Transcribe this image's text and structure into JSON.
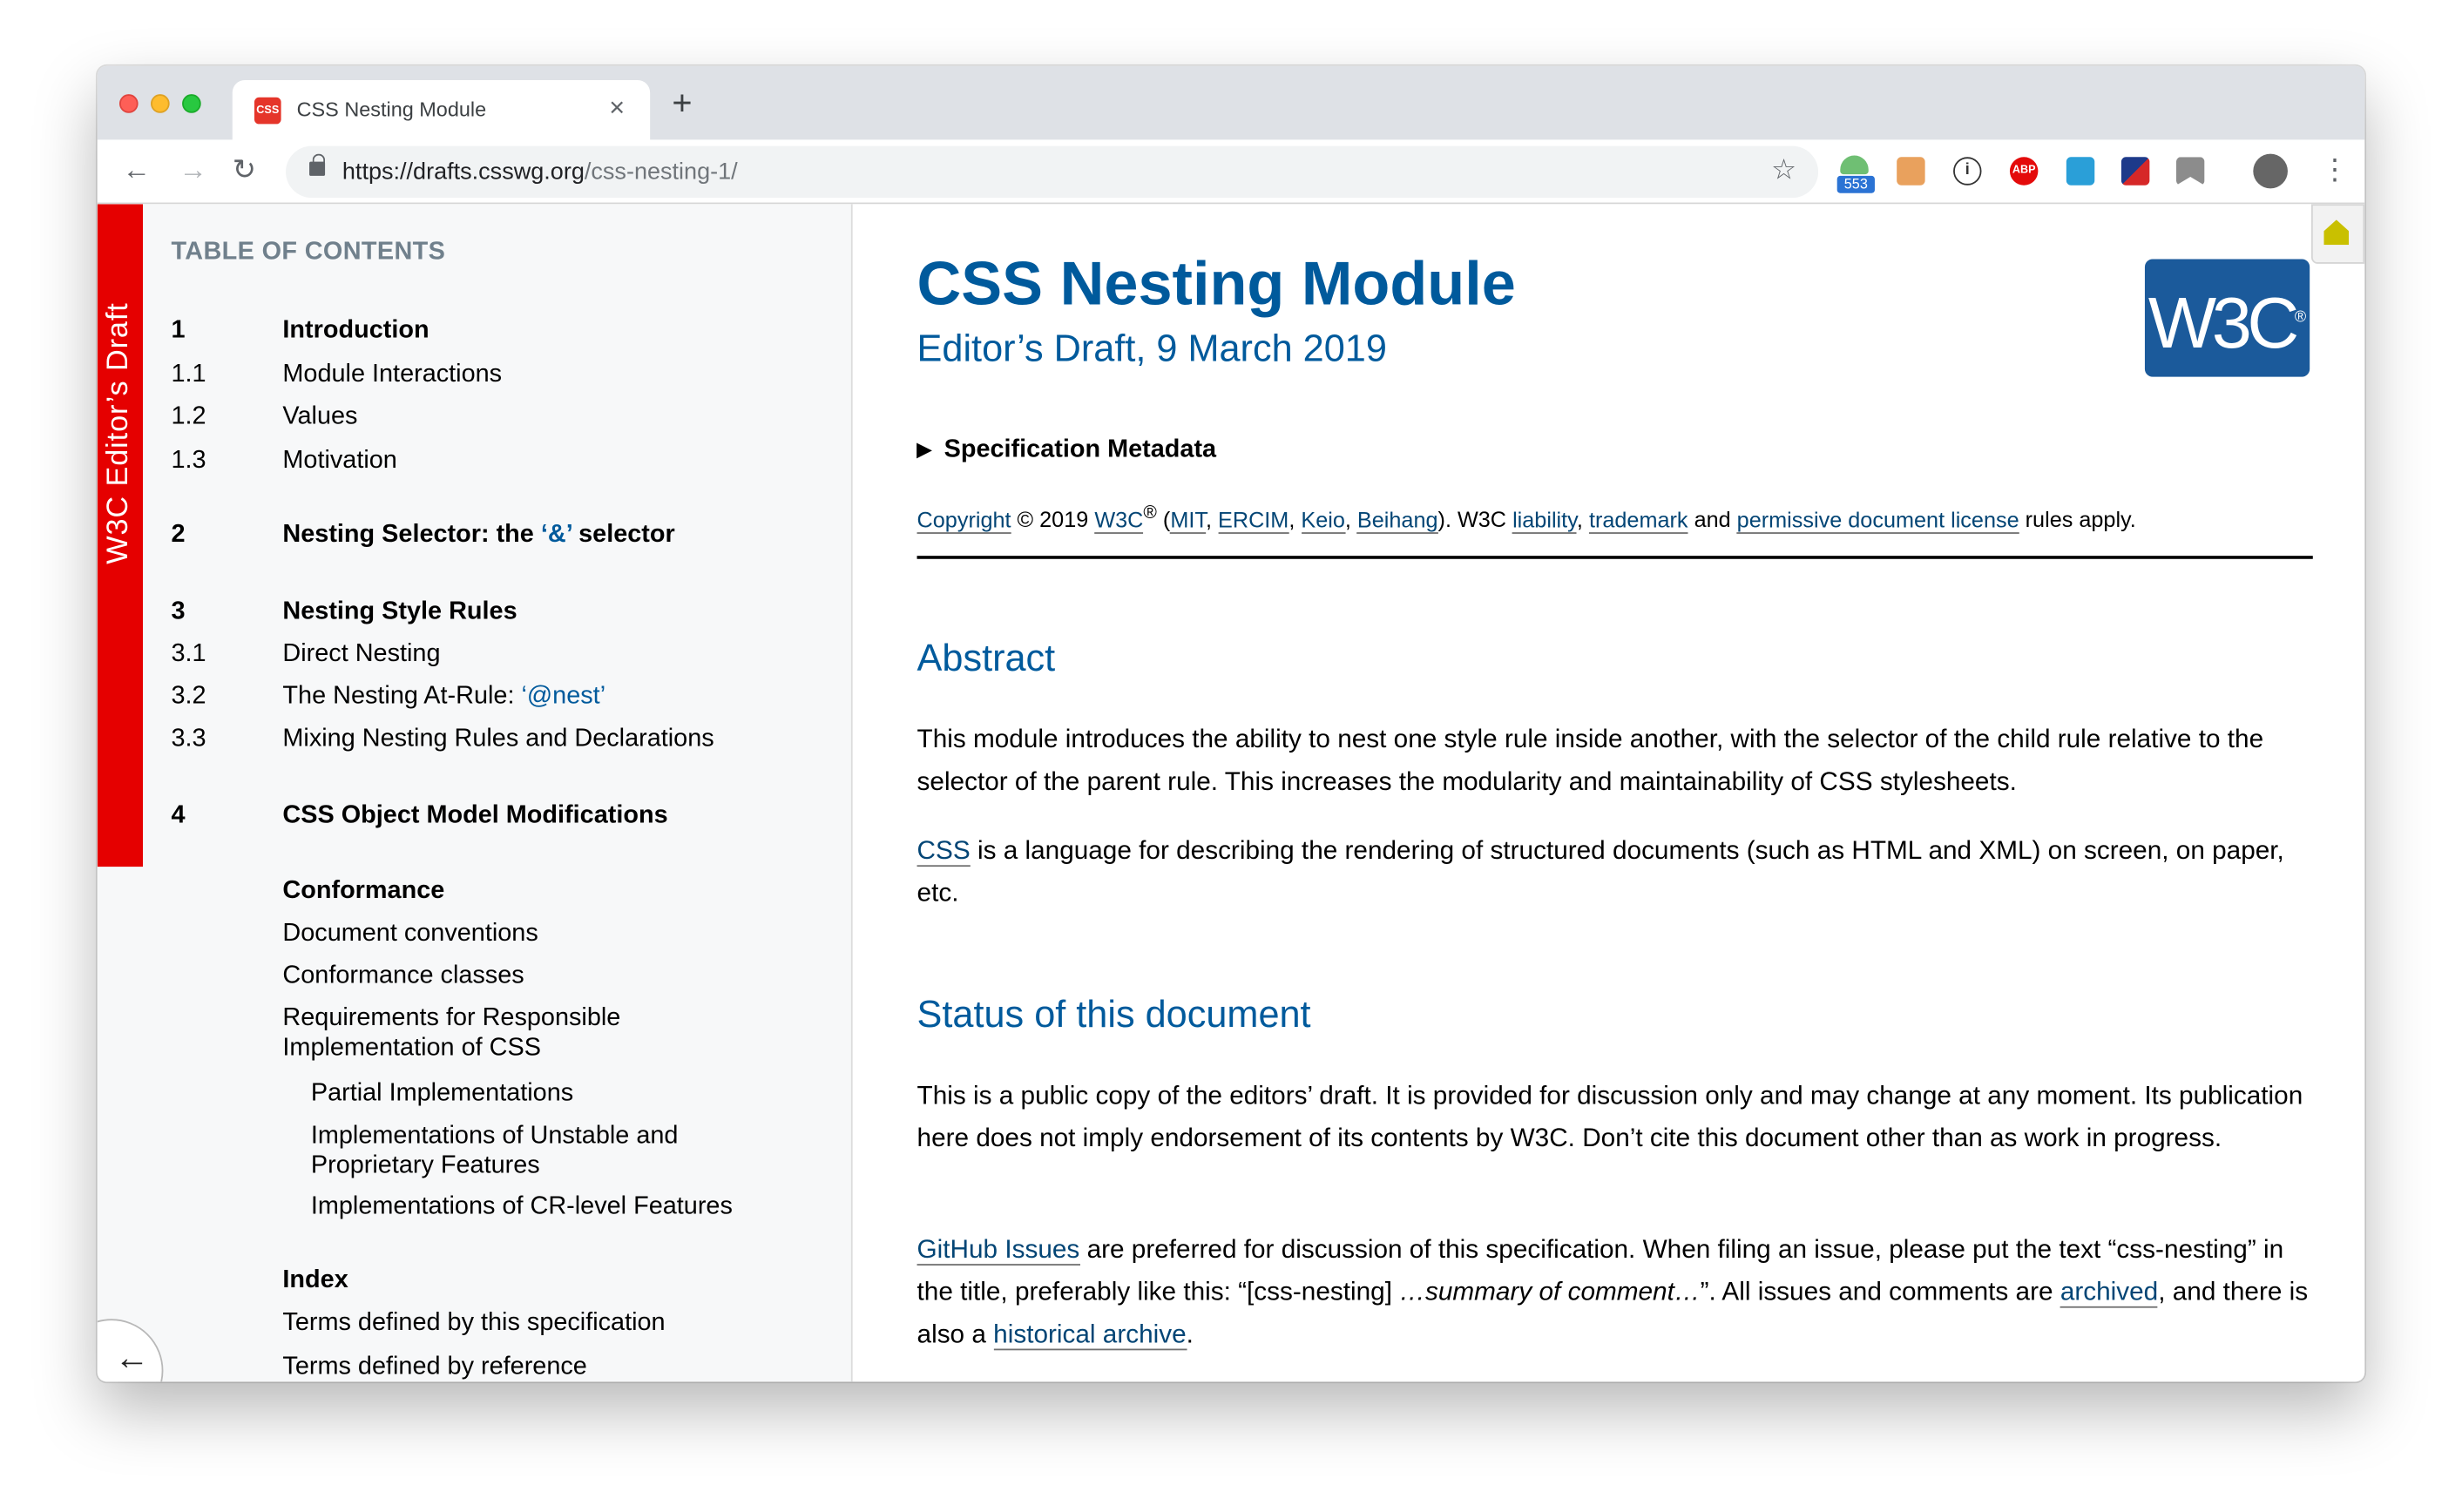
{
  "browser": {
    "tab": {
      "favicon_text": "CSS",
      "title": "CSS Nesting Module",
      "close_glyph": "×"
    },
    "new_tab_glyph": "+",
    "nav": {
      "back": "←",
      "forward": "→",
      "reload": "↻"
    },
    "url": {
      "host": "https://drafts.csswg.org",
      "path": "/css-nesting-1/"
    },
    "star_glyph": "☆",
    "extensions": [
      {
        "name": "android-extension-icon",
        "badge": "553"
      },
      {
        "name": "cookie-extension-icon"
      },
      {
        "name": "onepassword-icon",
        "text": "①"
      },
      {
        "name": "adblock-plus-icon",
        "text": "ABP"
      },
      {
        "name": "window-extension-icon"
      },
      {
        "name": "flag-extension-icon"
      },
      {
        "name": "bookmark-extension-icon"
      },
      {
        "name": "profile-avatar"
      }
    ],
    "menu_glyph": "⋮"
  },
  "sidebar": {
    "banner": "W3C Editor’s Draft",
    "toc_heading": "TABLE OF CONTENTS",
    "items": [
      {
        "num": "1",
        "label": "Introduction"
      },
      {
        "num": "1.1",
        "label": "Module Interactions"
      },
      {
        "num": "1.2",
        "label": "Values"
      },
      {
        "num": "1.3",
        "label": "Motivation"
      },
      {
        "num": "2",
        "label": "Nesting Selector: the ",
        "code": "‘&’",
        "label_after": " selector"
      },
      {
        "num": "3",
        "label": "Nesting Style Rules"
      },
      {
        "num": "3.1",
        "label": "Direct Nesting"
      },
      {
        "num": "3.2",
        "label": "The Nesting At-Rule: ",
        "code": "‘@nest’"
      },
      {
        "num": "3.3",
        "label": "Mixing Nesting Rules and Declarations"
      },
      {
        "num": "4",
        "label": "CSS Object Model Modifications"
      },
      {
        "label": "Conformance"
      },
      {
        "label": "Document conventions"
      },
      {
        "label": "Conformance classes"
      },
      {
        "label": "Requirements for Responsible",
        "label2": "Implementation of CSS"
      },
      {
        "label": "Partial Implementations"
      },
      {
        "label": "Implementations of Unstable and",
        "label2": "Proprietary Features"
      },
      {
        "label": "Implementations of CR-level Features"
      },
      {
        "label": "Index"
      },
      {
        "label": "Terms defined by this specification"
      },
      {
        "label": "Terms defined by reference"
      }
    ],
    "back_glyph": "←"
  },
  "content": {
    "title": "CSS Nesting Module",
    "subtitle": "Editor’s Draft, 9 March 2019",
    "logo_text": "W3C",
    "logo_reg": "®",
    "metadata_toggle": "▶",
    "metadata_label": "Specification Metadata",
    "copyright": {
      "copyright_link": "Copyright",
      "year": " © 2019 ",
      "w3c": "W3C",
      "reg": "®",
      "open": " (",
      "mit": "MIT",
      "comma1": ", ",
      "ercim": "ERCIM",
      "comma2": ", ",
      "keio": "Keio",
      "comma3": ", ",
      "beihang": "Beihang",
      "mid": "). W3C ",
      "liability": "liability",
      "comma4": ", ",
      "trademark": "trademark",
      "and": " and ",
      "license": "permissive document license",
      "end": " rules apply."
    },
    "abstract_heading": "Abstract",
    "abstract_p1": "This module introduces the ability to nest one style rule inside another, with the selector of the child rule relative to the selector of the parent rule. This increases the modularity and maintainability of CSS stylesheets.",
    "abstract_p2_link": "CSS",
    "abstract_p2": " is a language for describing the rendering of structured documents (such as HTML and XML) on screen, on paper, etc.",
    "status_heading": "Status of this document",
    "status_p1": "This is a public copy of the editors’ draft. It is provided for discussion only and may change at any moment. Its publication here does not imply endorsement of its contents by W3C. Don’t cite this document other than as work in progress.",
    "status_p2": {
      "github_link": "GitHub Issues",
      "t1": " are preferred for discussion of this specification. When filing an issue, please put the text “css-nesting” in the title, preferably like this: “[css-nesting] ",
      "em": "…summary of comment…",
      "t2": "”. All issues and comments are ",
      "archived_link": "archived",
      "t3": ", and there is also a ",
      "historical_link": "historical archive",
      "t4": "."
    }
  },
  "colors": {
    "spec_blue": "#005a9c",
    "draft_red": "#e50000",
    "link": "#034575",
    "w3c_logo": "#1b5a9b"
  }
}
